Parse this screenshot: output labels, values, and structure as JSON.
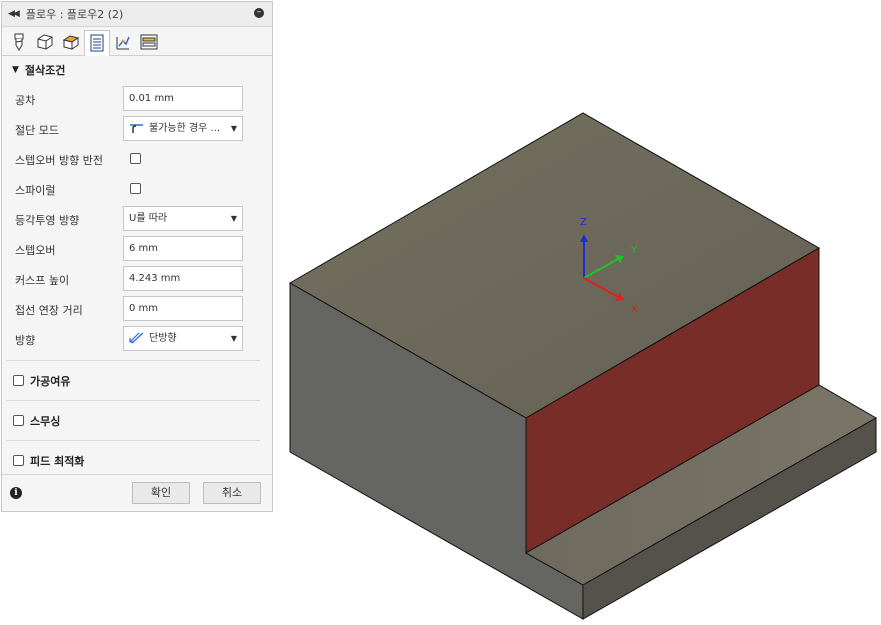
{
  "panel": {
    "title": "플로우 : 플로우2 (2)",
    "tabs": [
      {
        "icon": "tool-icon"
      },
      {
        "icon": "geometry-icon"
      },
      {
        "icon": "heights-icon"
      },
      {
        "icon": "passes-icon"
      },
      {
        "icon": "linking-icon"
      },
      {
        "icon": "post-process-icon"
      }
    ],
    "active_tab": 3,
    "section_title": "절삭조건",
    "fields": {
      "tolerance_label": "공차",
      "tolerance_value": "0.01 mm",
      "cutting_mode_label": "절단 모드",
      "cutting_mode_value": "불가능한 경우 ...",
      "reverse_stepover_label": "스텝오버 방향 반전",
      "spiral_label": "스파이럴",
      "iso_direction_label": "등각투영 방향",
      "iso_direction_value": "U를 따라",
      "stepover_label": "스텝오버",
      "stepover_value": "6 mm",
      "cusp_height_label": "커스프 높이",
      "cusp_height_value": "4.243 mm",
      "tangent_extension_label": "접선 연장 거리",
      "tangent_extension_value": "0 mm",
      "direction_label": "방향",
      "direction_value": "단방향"
    },
    "collapsed_sections": {
      "stock_to_leave": "가공여유",
      "smoothing": "스무싱",
      "feed_optimization": "피드 최적화"
    },
    "ok_label": "확인",
    "cancel_label": "취소"
  },
  "viewport": {
    "axis_x": "X",
    "axis_y": "Y",
    "axis_z": "Z",
    "colors": {
      "top_face": "#6f6a5e",
      "left_face": "#646562",
      "selected_face": "#782d28",
      "step_top": "#6d695e",
      "axis_x": "#e21f1f",
      "axis_y": "#22c22a",
      "axis_z": "#1b2fd6"
    }
  }
}
